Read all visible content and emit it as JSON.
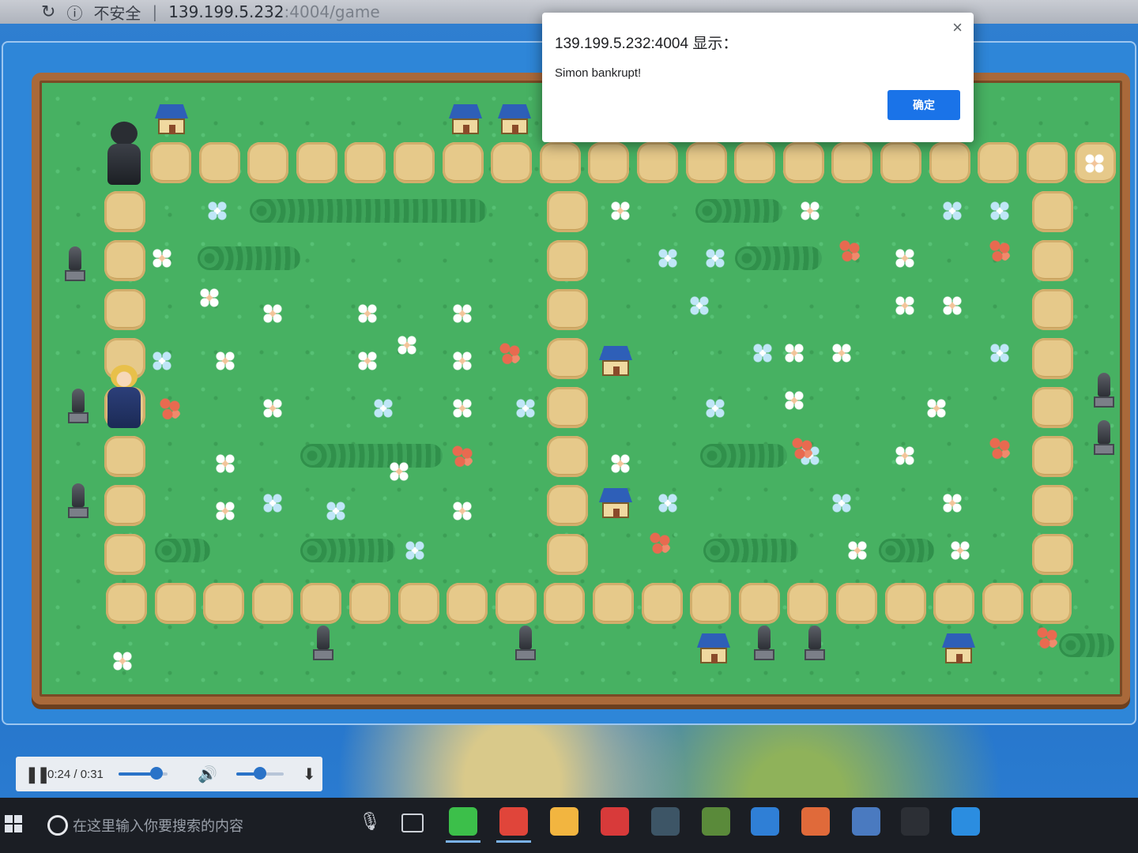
{
  "browser": {
    "security_label": "不安全",
    "url_host": "139.199.5.232",
    "url_rest": ":4004/game"
  },
  "alert": {
    "title": "139.199.5.232:4004 显示：",
    "message": "Simon bankrupt!",
    "ok_label": "确定",
    "close_glyph": "×"
  },
  "media": {
    "pause_glyph": "❚❚",
    "time": "0:24 / 0:31",
    "progress": 0.77,
    "volume_glyph": "🔊",
    "volume": 0.5,
    "download_glyph": "⬇"
  },
  "taskbar": {
    "search_placeholder": "在这里输入你要搜索的内容",
    "mic_glyph": "🎙",
    "apps": [
      {
        "name": "wechat",
        "color": "#3cbf4a"
      },
      {
        "name": "chrome",
        "color": "#e0453a"
      },
      {
        "name": "file-explorer",
        "color": "#f2b540"
      },
      {
        "name": "youdao",
        "color": "#d83a3a"
      },
      {
        "name": "app-tree",
        "color": "#3d5566"
      },
      {
        "name": "photo-viewer",
        "color": "#5a8a3a"
      },
      {
        "name": "wps-writer",
        "color": "#2f7fd6"
      },
      {
        "name": "wps-presentation",
        "color": "#e06a3a"
      },
      {
        "name": "file-manager",
        "color": "#4a7ac0"
      },
      {
        "name": "terminal",
        "color": "#2c2f35"
      },
      {
        "name": "quick-assist",
        "color": "#2b8de0"
      }
    ]
  },
  "colors": {
    "grass": "#47b162",
    "path": "#e6c98a",
    "board_border": "#a9693a",
    "dialog_button": "#1a73e8",
    "water": "#2e86d8"
  }
}
